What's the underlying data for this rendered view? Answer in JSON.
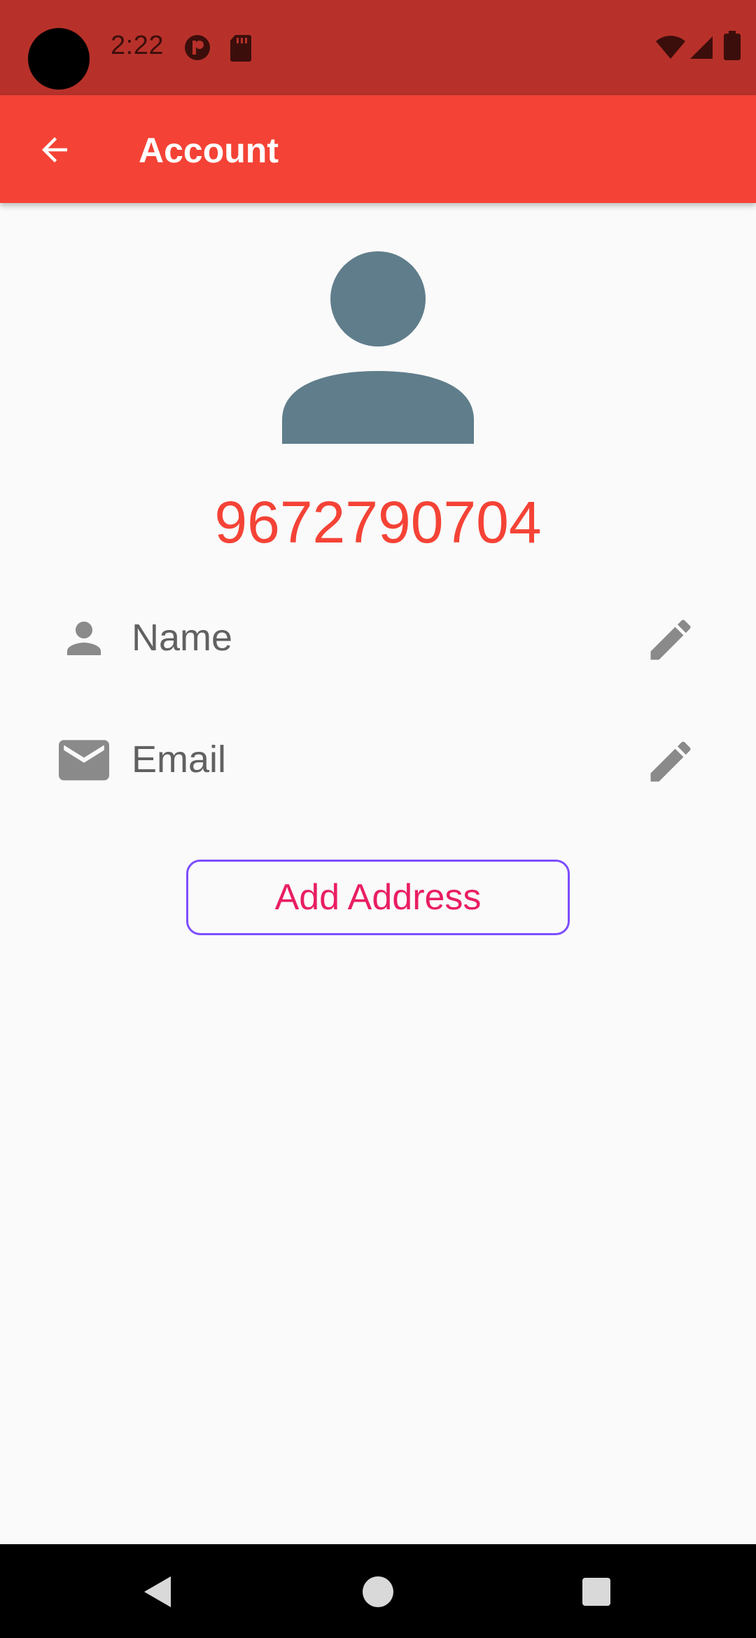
{
  "status_bar": {
    "time": "2:22",
    "background": "#b7312a",
    "icons": [
      "notification-icon",
      "sd-card-icon",
      "wifi-icon",
      "signal-icon",
      "battery-icon"
    ]
  },
  "app_bar": {
    "title": "Account",
    "background": "#f44336",
    "back_icon": "arrow-back-icon"
  },
  "profile": {
    "avatar_icon": "person-avatar-icon",
    "avatar_color": "#607d8b",
    "phone": "9672790704",
    "phone_color": "#f44336"
  },
  "fields": [
    {
      "icon": "person-icon",
      "label": "Name",
      "action_icon": "pencil-edit-icon"
    },
    {
      "icon": "email-icon",
      "label": "Email",
      "action_icon": "pencil-edit-icon"
    }
  ],
  "actions": {
    "add_address_label": "Add Address",
    "border_color": "#7c4dff",
    "text_color": "#e91e63"
  },
  "nav_bar": {
    "icons": [
      "back-triangle-icon",
      "home-circle-icon",
      "recents-square-icon"
    ]
  }
}
